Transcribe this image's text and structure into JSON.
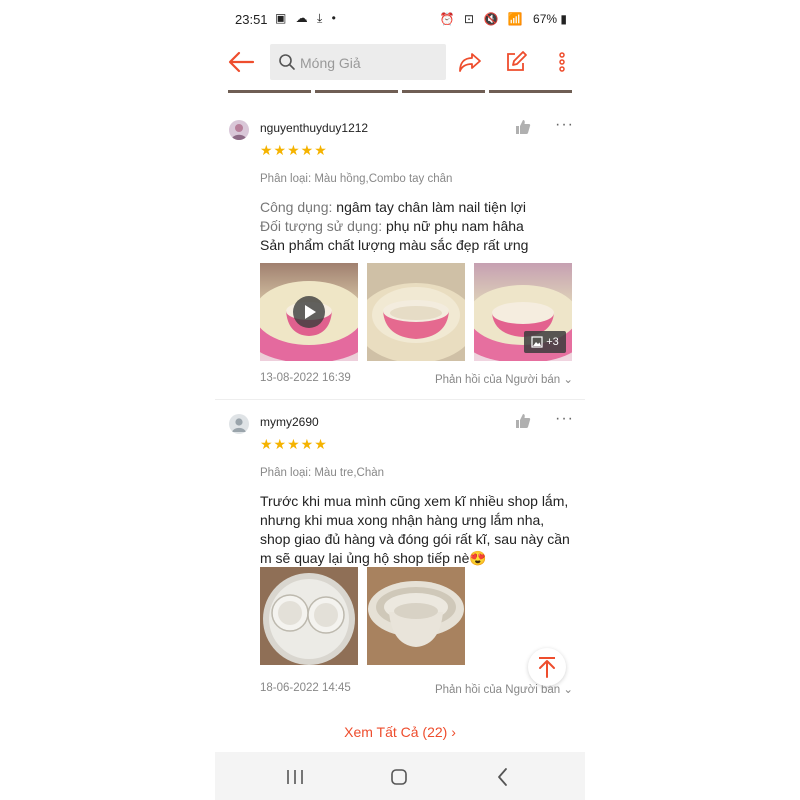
{
  "status_bar": {
    "time": "23:51",
    "left_icons": "▣ ☁ ⤓ •",
    "right_icons": "⏰ ⊡ 🔇 📶",
    "battery": "67%"
  },
  "search": {
    "placeholder": "Móng Giả"
  },
  "reviews": [
    {
      "username": "nguyenthuyduy1212",
      "stars": "★★★★★",
      "variant": "Phân loại: Màu hồng,Combo tay chân",
      "lines": [
        {
          "label": "Công dụng: ",
          "text": "ngâm tay chân làm nail tiện lợi"
        },
        {
          "label": "Đối tượng sử dụng: ",
          "text": "phụ nữ phụ nam hâha"
        },
        {
          "label": "",
          "text": "Sản phẩm chất lượng màu sắc đẹp rất ưng"
        }
      ],
      "more_photos": "+3",
      "date": "13-08-2022 16:39",
      "reply": "Phản hồi của Người bán"
    },
    {
      "username": "mymy2690",
      "stars": "★★★★★",
      "variant": "Phân loại: Màu tre,Chàn",
      "text": "Trước khi mua mình cũng xem kĩ nhiều shop lắm, nhưng khi mua xong nhận hàng ưng lắm nha, shop giao đủ hàng và đóng gói rất kĩ, sau này cần m sẽ quay lại ủng hộ shop tiếp nè😍",
      "date": "18-06-2022 14:45",
      "reply": "Phản hồi của Người bán"
    }
  ],
  "see_all": "Xem Tất Cả (22) ›",
  "colors": {
    "accent": "#ee4d2d",
    "star": "#f5b300",
    "muted": "#888888"
  },
  "icons": [
    "back-arrow-icon",
    "search-icon",
    "share-icon",
    "edit-icon",
    "more-vertical-icon",
    "thumbs-up-icon",
    "ellipsis-icon",
    "play-icon",
    "image-icon",
    "scroll-top-icon",
    "recent-apps-icon",
    "home-icon",
    "nav-back-icon"
  ]
}
